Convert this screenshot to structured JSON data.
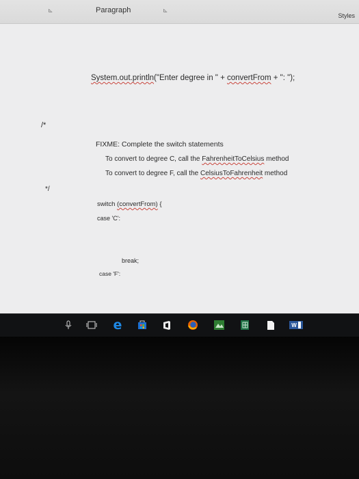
{
  "ribbon": {
    "launcher_glyph": "⊾",
    "paragraph": "Paragraph",
    "styles": "Styles"
  },
  "document": {
    "println": {
      "method": "System.out.println",
      "part1": "(\"Enter degree in \" + ",
      "var": "convertFrom",
      "part2": " + \": \");"
    },
    "comment_open": "/*",
    "fixme": "FIXME: Complete the switch statements",
    "line_c": {
      "pre": "To convert to degree C, call the ",
      "method": "FahrenheitToCelsius",
      "post": " method"
    },
    "line_f": {
      "pre": "To convert to degree F, call the ",
      "method": "CelsiusToFahrenheit",
      "post": " method"
    },
    "comment_close": "*/",
    "switch": {
      "pre": "switch ",
      "expr": "(convertFrom)",
      "post": " {"
    },
    "case_c": "case 'C':",
    "break": "break;",
    "case_f": "case 'F':"
  },
  "taskbar": {
    "icons": [
      "microphone-icon",
      "task-view-icon",
      "edge-icon",
      "store-icon",
      "office-icon",
      "firefox-icon",
      "app-icon",
      "excel-icon",
      "file-icon",
      "word-icon"
    ],
    "word_letter": "W"
  },
  "colors": {
    "page": "#ededee",
    "ribbon": "#dcdcdc",
    "taskbar": "#111214",
    "squiggle": "#c9463d",
    "edge_blue": "#1e88e5",
    "excel_green": "#1e7145"
  }
}
